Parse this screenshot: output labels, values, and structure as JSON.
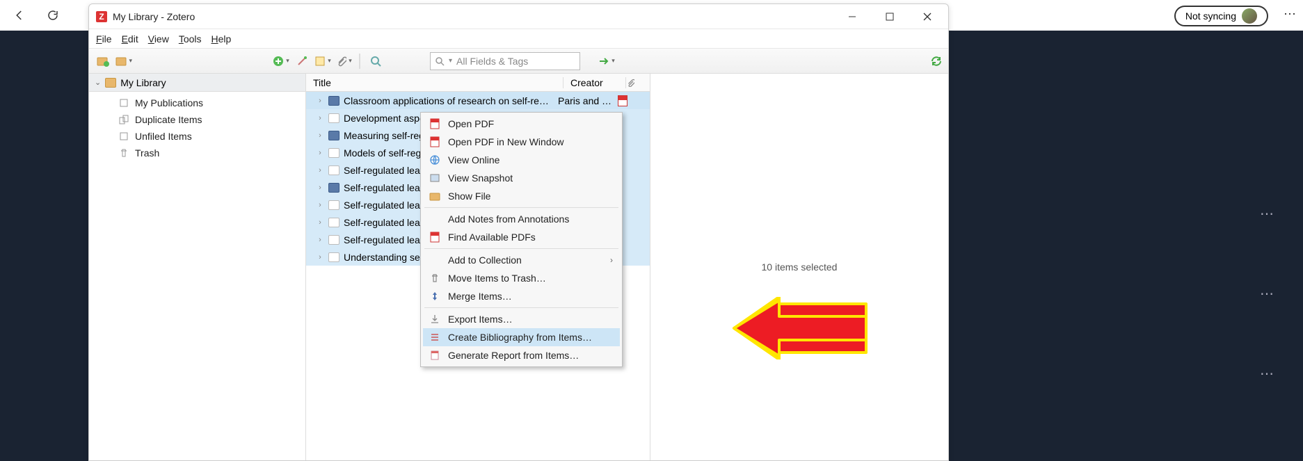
{
  "browser": {
    "sync_label": "Not syncing"
  },
  "window": {
    "title": "My Library - Zotero"
  },
  "menubar": {
    "file": "File",
    "edit": "Edit",
    "view": "View",
    "tools": "Tools",
    "help": "Help"
  },
  "search": {
    "placeholder": "All Fields & Tags"
  },
  "library": {
    "header": "My Library",
    "items": [
      {
        "label": "My Publications"
      },
      {
        "label": "Duplicate Items"
      },
      {
        "label": "Unfiled Items"
      },
      {
        "label": "Trash"
      }
    ]
  },
  "columns": {
    "title": "Title",
    "creator": "Creator"
  },
  "items_list": [
    {
      "title": "Classroom applications of research on self-re…",
      "creator": "Paris and …",
      "icon": "book",
      "pdf": true
    },
    {
      "title": "Development aspects of self-regula",
      "creator": "",
      "icon": "doc"
    },
    {
      "title": "Measuring self-regulated learning",
      "creator": "",
      "icon": "book"
    },
    {
      "title": "Models of self-regulated learning: A",
      "creator": "",
      "icon": "doc"
    },
    {
      "title": "Self-regulated learning and academ",
      "creator": "",
      "icon": "doc"
    },
    {
      "title": "Self-regulated learning and academ",
      "creator": "",
      "icon": "book"
    },
    {
      "title": "Self-regulated learning and perform",
      "creator": "",
      "icon": "doc"
    },
    {
      "title": "Self-regulated learning: The educat",
      "creator": "",
      "icon": "doc"
    },
    {
      "title": "Self-regulated learning: Where we a",
      "creator": "",
      "icon": "doc"
    },
    {
      "title": "Understanding self-regulated learni",
      "creator": "",
      "icon": "doc"
    }
  ],
  "context_menu": [
    {
      "label": "Open PDF",
      "icon": "pdf"
    },
    {
      "label": "Open PDF in New Window",
      "icon": "pdf"
    },
    {
      "label": "View Online",
      "icon": "globe"
    },
    {
      "label": "View Snapshot",
      "icon": "snapshot"
    },
    {
      "label": "Show File",
      "icon": "folder"
    },
    {
      "sep": true
    },
    {
      "label": "Add Notes from Annotations",
      "icon": ""
    },
    {
      "label": "Find Available PDFs",
      "icon": "pdf"
    },
    {
      "sep": true
    },
    {
      "label": "Add to Collection",
      "icon": "",
      "more": true
    },
    {
      "label": "Move Items to Trash…",
      "icon": "trash"
    },
    {
      "label": "Merge Items…",
      "icon": "merge"
    },
    {
      "sep": true
    },
    {
      "label": "Export Items…",
      "icon": "export"
    },
    {
      "label": "Create Bibliography from Items…",
      "icon": "list",
      "highlight": true
    },
    {
      "label": "Generate Report from Items…",
      "icon": "report"
    }
  ],
  "status": {
    "selected": "10 items selected"
  }
}
